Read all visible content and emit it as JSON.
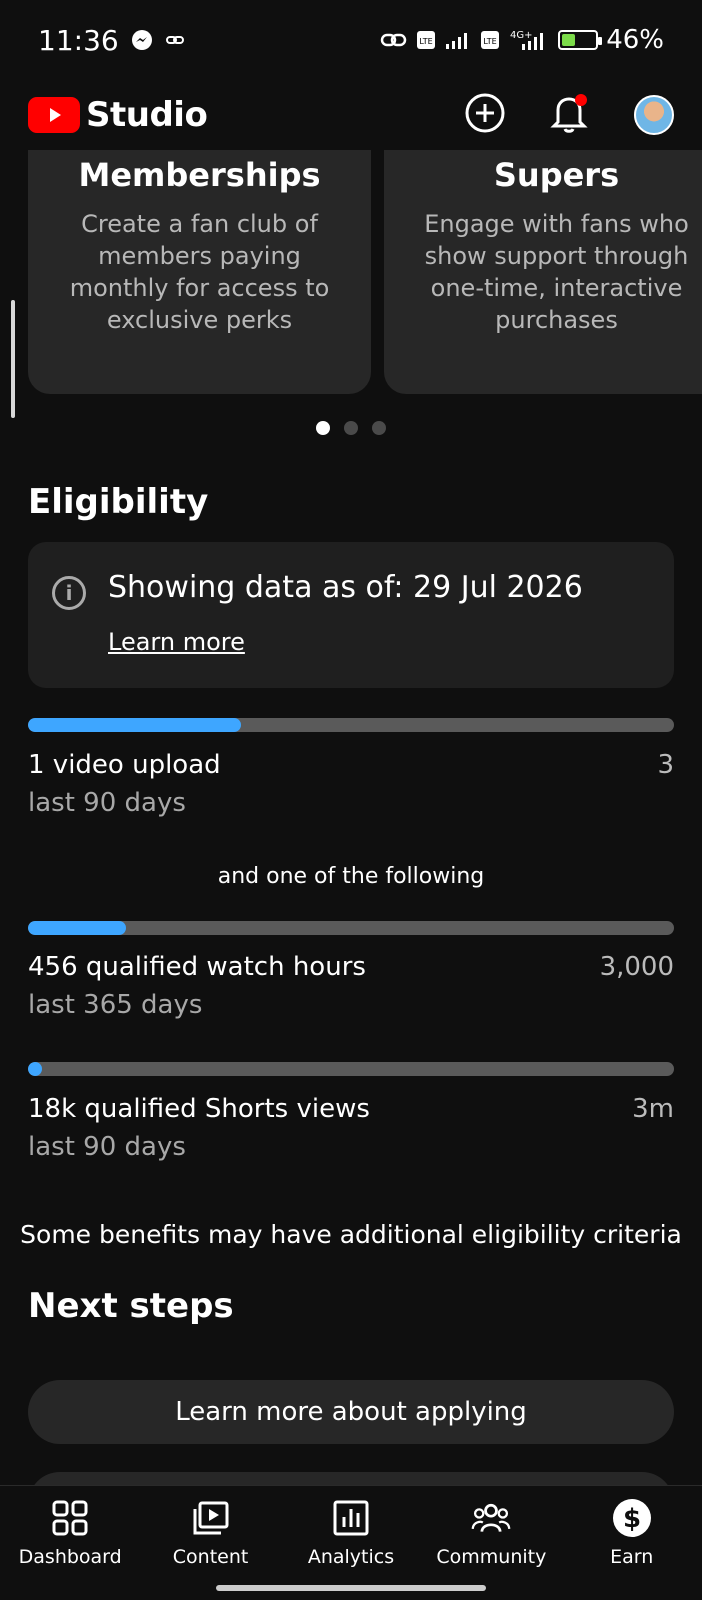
{
  "status_bar": {
    "time": "11:36",
    "battery_percent": "46%",
    "battery_level": 0.46,
    "icons": [
      "messenger-icon",
      "link-icon",
      "link-icon",
      "volte-icon",
      "signal-icon",
      "volte-icon",
      "4g-signal-icon",
      "battery-icon"
    ]
  },
  "header": {
    "app_name": "Studio",
    "brand_color": "#ff0000",
    "actions": [
      "add-icon",
      "notifications-icon",
      "avatar"
    ]
  },
  "carousel": {
    "cards": [
      {
        "title": "Memberships",
        "text": "Create a fan club of members paying monthly for access to exclusive perks"
      },
      {
        "title": "Supers",
        "text": "Engage with fans who show support through one-time, interactive purchases"
      }
    ],
    "active_index": 0,
    "count": 3
  },
  "eligibility": {
    "title": "Eligibility",
    "info": {
      "text": "Showing data as of: 29 Jul 2026",
      "link": "Learn more"
    },
    "requirements": [
      {
        "label": "1 video upload",
        "sub": "last 90 days",
        "target": "3",
        "progress": 0.33
      },
      {
        "label": "456 qualified watch hours",
        "sub": "last 365 days",
        "target": "3,000",
        "progress": 0.152
      },
      {
        "label": "18k qualified Shorts views",
        "sub": "last 90 days",
        "target": "3m",
        "progress": 0.006
      }
    ],
    "connector": "and one of the following",
    "note": "Some benefits may have additional eligibility criteria",
    "accent_color": "#3ea6ff"
  },
  "next_steps": {
    "title": "Next steps",
    "button_label": "Learn more about applying"
  },
  "bottom_nav": {
    "items": [
      {
        "label": "Dashboard",
        "icon": "dashboard-icon"
      },
      {
        "label": "Content",
        "icon": "content-icon"
      },
      {
        "label": "Analytics",
        "icon": "analytics-icon"
      },
      {
        "label": "Community",
        "icon": "community-icon"
      },
      {
        "label": "Earn",
        "icon": "earn-icon"
      }
    ]
  }
}
